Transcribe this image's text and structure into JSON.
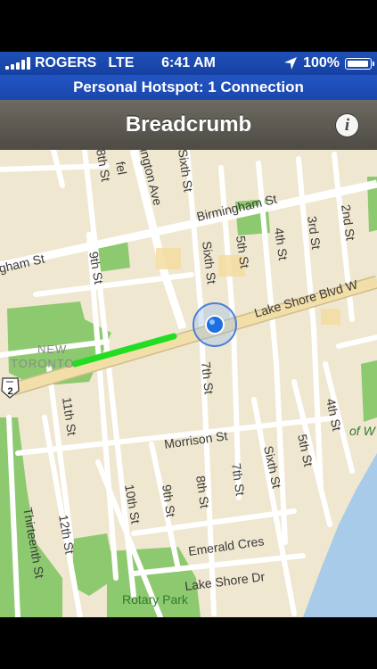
{
  "status_bar": {
    "carrier": "ROGERS",
    "network": "LTE",
    "time": "6:41 AM",
    "battery_percent": "100%",
    "battery_level": 1.0,
    "location_icon": "location-arrow-icon",
    "battery_icon": "battery-charging-icon"
  },
  "hotspot_banner": {
    "text": "Personal Hotspot: 1 Connection"
  },
  "nav_bar": {
    "title": "Breadcrumb",
    "info_label": "i",
    "info_icon": "info-icon"
  },
  "map": {
    "streets": {
      "birmingham_st_right": "Birmingham St",
      "birmingham_st_left": "gham St",
      "lake_shore_blvd": "Lake Shore Blvd W",
      "morrison_st": "Morrison St",
      "emerald_cres": "Emerald Cres",
      "lake_shore_dr": "Lake Shore Dr",
      "eighth_st_top": "8th St",
      "ninth_st_top": "9th St",
      "islington_ave": "ington Ave",
      "islington_ave_fragment": "fel",
      "sixth_st_top": "Sixth St",
      "sixth_st_mid": "Sixth St",
      "fifth_st": "5th St",
      "fourth_st_top": "4th St",
      "third_st": "3rd St",
      "second_st": "2nd St",
      "seventh_st_mid": "7th St",
      "eleventh_st": "11th St",
      "fourth_st_bottom": "4th St",
      "fifth_st_bottom": "5th St",
      "sixth_st_bottom": "Sixth St",
      "seventh_st_bottom": "7th St",
      "eighth_st_bottom": "8th St",
      "ninth_st_bottom": "9th St",
      "tenth_st": "10th St",
      "twelfth_st": "12th St",
      "thirteenth_st": "Thirteenth St"
    },
    "places": {
      "new_toronto_1": "NEW",
      "new_toronto_2": "TORONTO",
      "rotary_park": "Rotary Park",
      "water_label": "of W"
    },
    "route_shield": "2",
    "colors": {
      "land": "#efe7d0",
      "park": "#8dc96f",
      "water": "#a8cbe9",
      "road": "#ffffff",
      "major_road": "#f2dea8",
      "breadcrumb_trail": "#22dd22",
      "location_dot": "#1e6fe0"
    }
  }
}
